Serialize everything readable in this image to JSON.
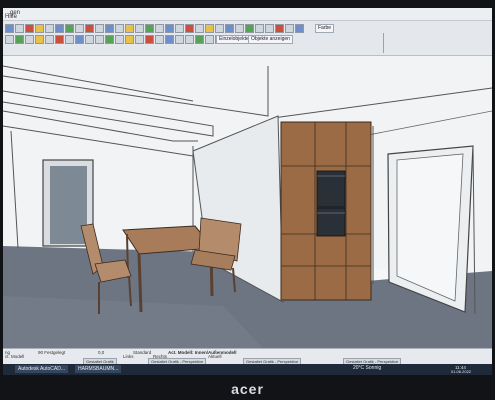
{
  "menubar": {
    "items": [
      "...gen",
      "Hilfe"
    ]
  },
  "toolbar": {
    "label_a": "Einzelobjekte",
    "label_b": "Objekte anzeigen",
    "dropdown": "Farbe"
  },
  "status": {
    "s1": "ng",
    "s2": "90 Festgelegt",
    "s3": "0,0",
    "s4": "Standard",
    "s5": "Act. Modell: Innen/Außenmodell",
    "s6": "ct. Modell",
    "s7": "Links",
    "s8": "Rechts",
    "s9": "Aktuell"
  },
  "tabs": [
    "Gestaltet Grafik",
    "Gestaltet Grafik - Perspektive",
    "Gestaltet Grafik - Perspektive",
    "Gestaltet Grafik - Perspektive"
  ],
  "taskbar": {
    "task1": "Autodesk AutoCAD...",
    "task2": "HARMSBAUMN...",
    "weather": "20°C Sonnig",
    "time": "11:44",
    "date": "01.06.2022"
  },
  "monitor": {
    "brand": "acer"
  },
  "colors": {
    "wood": "#9a6b44",
    "floor": "#6d7582",
    "oven": "#2a3038"
  }
}
